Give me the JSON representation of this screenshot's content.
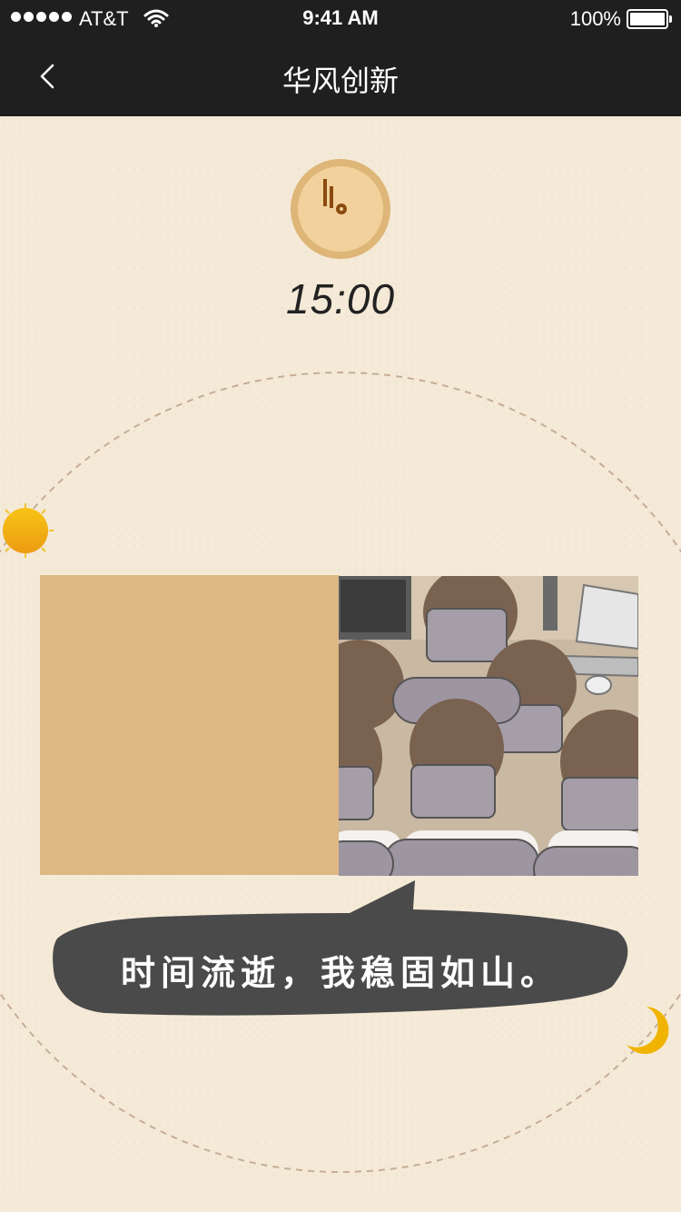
{
  "status_bar": {
    "carrier": "AT&T",
    "time": "9:41 AM",
    "battery": "100%"
  },
  "nav": {
    "title": "华风创新"
  },
  "clock": {
    "time": "15:00"
  },
  "scene": {
    "caption": "时间流逝，我稳固如山。"
  },
  "colors": {
    "background": "#f4ead7",
    "navbar": "#1f1f1f",
    "badge": "#deb678",
    "panel": "#deb883",
    "bubble": "#4a4a4a",
    "sun": "#f2a400",
    "moon": "#f0b400"
  },
  "icons": [
    "back-chevron-icon",
    "wifi-icon",
    "battery-icon",
    "clock-hands-icon",
    "sun-icon",
    "moon-icon"
  ]
}
